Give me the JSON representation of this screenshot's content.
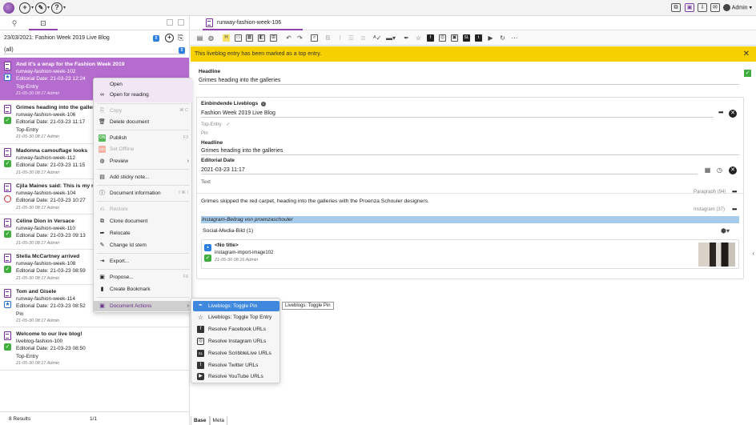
{
  "topbar": {
    "admin_label": "Admin",
    "icons": [
      "logo-icon",
      "add-icon",
      "tools-icon",
      "help-icon",
      "windows-icon",
      "purple-panel-icon",
      "inbox-icon",
      "mail-icon",
      "user-icon"
    ]
  },
  "left": {
    "filter_value": "23/03/2021: Fashion Week 2019 Live Blog",
    "all_label": "(all)",
    "items": [
      {
        "title": "And it's a wrap for the Fashion Week 2019",
        "id": "runway-fashion-week-102",
        "date": "Editorial Date: 21-03-23 12:24",
        "tag": "Top-Entry",
        "meta": "21-05-30 08:17 Admin",
        "status": "blue"
      },
      {
        "title": "Grimes heading into the galleries",
        "id": "runway-fashion-week-106",
        "date": "Editorial Date: 21-03-23 11:17",
        "tag": "Top-Entry",
        "meta": "21-05-30 08:17 Admin",
        "status": "green"
      },
      {
        "title": "Madonna camouflage looks",
        "id": "runway-fashion-week-112",
        "date": "Editorial Date: 21-03-23 11:15",
        "tag": "",
        "meta": "21-05-30 08:17 Admin",
        "status": "green"
      },
      {
        "title": "Cjila Maines said: This is my m",
        "id": "runway-fashion-week-104",
        "date": "Editorial Date: 21-03-23 10:27",
        "tag": "",
        "meta": "21-05-30 08:17 Admin",
        "status": "red"
      },
      {
        "title": "Céline Dion in Versace",
        "id": "runway-fashion-week-110",
        "date": "Editorial Date: 21-03-23 09:13",
        "tag": "",
        "meta": "21-05-30 08:17 Admin",
        "status": "green"
      },
      {
        "title": "Stella McCartney arrived",
        "id": "runway-fashion-week-108",
        "date": "Editorial Date: 21-03-23 08:59",
        "tag": "",
        "meta": "21-05-30 08:17 Admin",
        "status": "green"
      },
      {
        "title": "Tom and Gisele",
        "id": "runway-fashion-week-114",
        "date": "Editorial Date: 21-03-23 08:52",
        "tag": "Pin",
        "meta": "21-05-30 08:17 Admin",
        "status": "blue"
      },
      {
        "title": "Welcome to our live blog!",
        "id": "liveblog-fashion-100",
        "date": "Editorial Date: 21-03-23 08:50",
        "tag": "Top-Entry",
        "meta": "21-05-30 08:17 Admin",
        "status": "green"
      }
    ],
    "results": "8 Results",
    "page": "1/1"
  },
  "context_menu": {
    "items": {
      "open": "Open",
      "open_reading": "Open for reading",
      "copy": "Copy",
      "copy_sc": "⌘ C",
      "delete": "Delete document",
      "publish": "Publish",
      "publish_sc": "F3",
      "set_offline": "Set Offline",
      "preview": "Preview",
      "sticky": "Add sticky note...",
      "docinfo": "Document information",
      "docinfo_sc": "⇧⌘ I",
      "restore": "Restore",
      "clone": "Clone document",
      "relocate": "Relocate",
      "change_id": "Change Id stem",
      "export": "Export...",
      "propose": "Propose...",
      "propose_sc": "F8",
      "bookmark": "Create Bookmark",
      "doc_actions": "Document Actions"
    }
  },
  "submenu": {
    "items": [
      "Liveblogs: Toggle Pin",
      "Liveblogs: Toggle Top Entry",
      "Resolve Facebook URLs",
      "Resolve Instagram URLs",
      "Resolve ScribbleLive URLs",
      "Resolve Twitter URLs",
      "Resolve YouTube URLs"
    ],
    "tooltip": "Liveblogs: Toggle Pin"
  },
  "editor": {
    "tab_label": "runway-fashion-week-106",
    "banner": "This liveblog entry has been marked as a top entry.",
    "headline_label": "Headline",
    "headline_value": "Grimes heading into the galleries",
    "card": {
      "embed_label": "Einbindende Liveblogs",
      "embed_value": "Fashion Week 2019 Live Blog",
      "top_entry": "Top-Entry",
      "pin": "Pin",
      "headline_label": "Headline",
      "headline_value": "Grimes heading into the galleries",
      "date_label": "Editorial Date",
      "date_value": "2021-03-23 11:17",
      "text_label": "Text",
      "paragraph_tag": "Paragraph (94)",
      "paragraph_text": "Grimes skipped the red carpet, heading into the galleries with the Proenza Schouler designers.",
      "instagram_tag": "Instagram (37)",
      "instagram_text": "Instagram-Beitrag von proenzaschouler",
      "social_label": "Social-Media-Bild (1)",
      "media_title": "<No title>",
      "media_id": "instagram-import-image102",
      "media_meta": "21-05-30 08:16 Admin"
    },
    "bottom_tabs": [
      "Base",
      "Meta"
    ]
  },
  "colors": {
    "accent": "#8e44ad",
    "selected_row": "#b56ccf",
    "banner": "#f7d000",
    "status_green": "#3fae3f",
    "submenu_active": "#3e88dd"
  }
}
